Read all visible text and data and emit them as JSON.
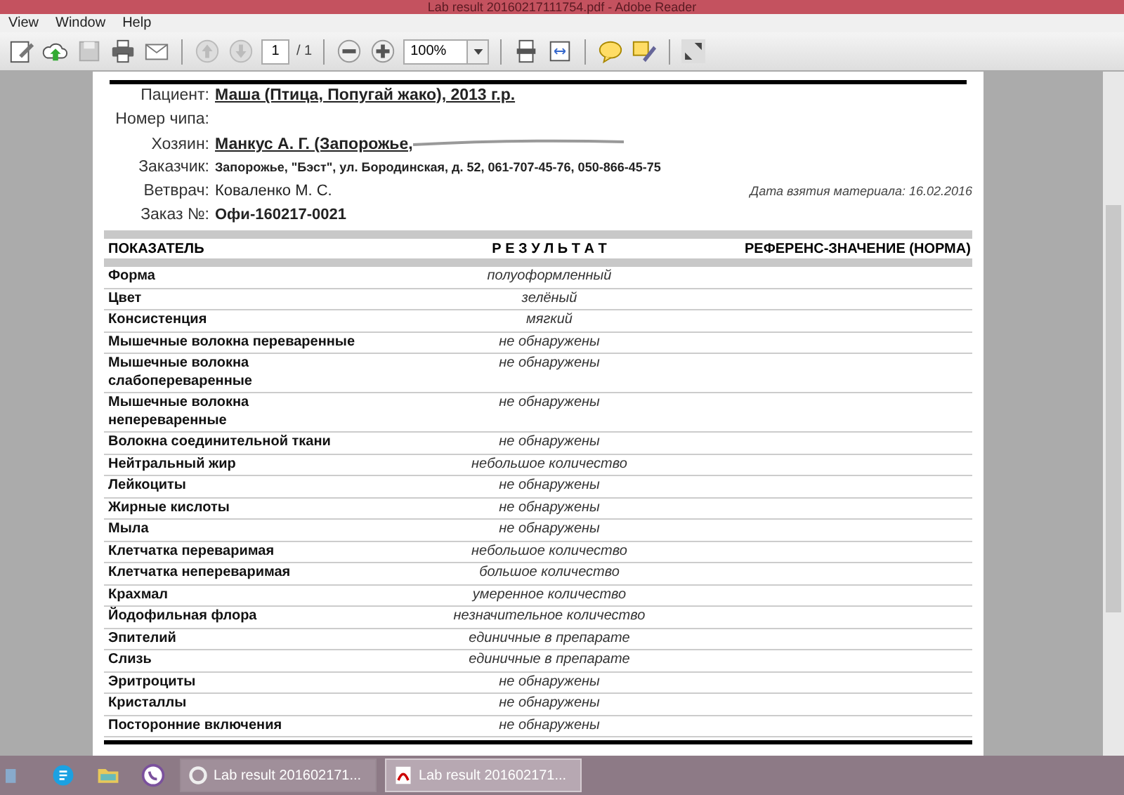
{
  "window": {
    "title": "Lab result 20160217111754.pdf - Adobe Reader"
  },
  "menu": [
    "View",
    "Window",
    "Help"
  ],
  "toolbar": {
    "page": "1",
    "page_total": "/ 1",
    "zoom": "100%"
  },
  "header": [
    {
      "label": "Пациент:",
      "value": "Маша (Птица, Попугай жако), 2013 г.р.",
      "kind": "underlined"
    },
    {
      "label": "Номер чипа:",
      "kind": "empty"
    },
    {
      "label": "Хозяин:",
      "value": "Манкус А. Г. (Запорожье,",
      "kind": "underlined"
    },
    {
      "label": "Заказчик:",
      "value": "Запорожье, \"Бэст\", ул. Бородинская, д. 52, 061-707-45-76, 050-866-45-75",
      "kind": "small"
    },
    {
      "label": "Ветврач:",
      "value": "Коваленко М. С.",
      "kind": "plain",
      "note": "Дата взятия материала: 16.02.2016"
    },
    {
      "label": "Заказ №:",
      "value": "Офи-160217-0021",
      "kind": "bold"
    }
  ],
  "table": {
    "columns": [
      "ПОКАЗАТЕЛЬ",
      "Р Е З У Л Ь Т А Т",
      "РЕФЕРЕНС-ЗНАЧЕНИЕ (НОРМА)"
    ],
    "rows": [
      {
        "name": "Форма",
        "result": "полуоформленный"
      },
      {
        "name": "Цвет",
        "result": "зелёный"
      },
      {
        "name": "Консистенция",
        "result": "мягкий"
      },
      {
        "name": "Мышечные волокна переваренные",
        "result": "не обнаружены"
      },
      {
        "name": "Мышечные волокна слабопереваренные",
        "result": "не обнаружены"
      },
      {
        "name": "Мышечные волокна непереваренные",
        "result": "не обнаружены"
      },
      {
        "name": "Волокна соединительной ткани",
        "result": "не обнаружены"
      },
      {
        "name": "Нейтральный жир",
        "result": "небольшое количество"
      },
      {
        "name": "Лейкоциты",
        "result": "не обнаружены"
      },
      {
        "name": "Жирные кислоты",
        "result": "не обнаружены"
      },
      {
        "name": "Мыла",
        "result": "не обнаружены"
      },
      {
        "name": "Клетчатка переваримая",
        "result": "небольшое количество"
      },
      {
        "name": "Клетчатка непереваримая",
        "result": "большое количество"
      },
      {
        "name": "Крахмал",
        "result": "умеренное количество"
      },
      {
        "name": "Йодофильная флора",
        "result": "незначительное количество"
      },
      {
        "name": "Эпителий",
        "result": "единичные в препарате"
      },
      {
        "name": "Слизь",
        "result": "единичные в препарате"
      },
      {
        "name": "Эритроциты",
        "result": "не обнаружены"
      },
      {
        "name": "Кристаллы",
        "result": "не обнаружены"
      },
      {
        "name": "Посторонние включения",
        "result": "не обнаружены"
      }
    ]
  },
  "taskbar": [
    {
      "label": "Lab result 201602171...",
      "selected": false
    },
    {
      "label": "Lab result 201602171...",
      "selected": true
    }
  ]
}
